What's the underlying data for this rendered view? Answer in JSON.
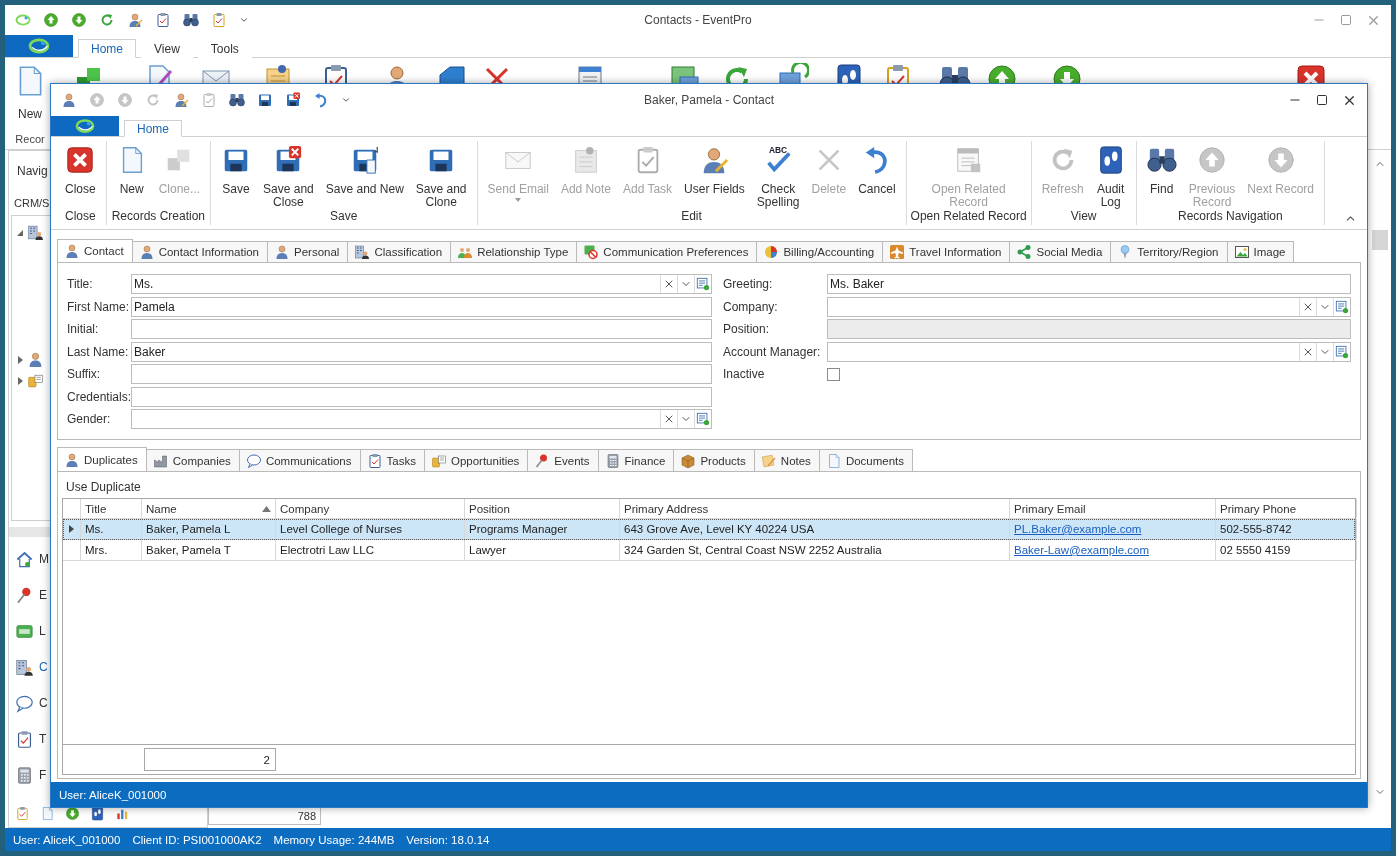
{
  "main_window": {
    "title": "Contacts - EventPro",
    "ribbon_tabs": [
      {
        "label": "Home",
        "selected": true
      },
      {
        "label": "View",
        "selected": false
      },
      {
        "label": "Tools",
        "selected": false
      }
    ],
    "ribbon_button": "New",
    "ribbon_group": "Recor",
    "navigation": {
      "title": "Navig",
      "tree_label": "CRM/S",
      "tree": [
        {
          "kind": "building",
          "expanded": true
        },
        {
          "kind": "person",
          "expanded": false
        },
        {
          "kind": "coins",
          "expanded": false
        }
      ],
      "items": [
        {
          "kind": "home",
          "label": "M",
          "selected": false
        },
        {
          "kind": "pushpin",
          "label": "E",
          "selected": false
        },
        {
          "kind": "card",
          "label": "L",
          "selected": false
        },
        {
          "kind": "building",
          "label": "C",
          "selected": true
        },
        {
          "kind": "bubble",
          "label": "C",
          "selected": false
        },
        {
          "kind": "task",
          "label": "T",
          "selected": false
        },
        {
          "kind": "calculator",
          "label": "F",
          "selected": false
        }
      ]
    },
    "footer_value": "788",
    "status_bar": [
      "User: AliceK_001000",
      "Client ID: PSI001000AK2",
      "Memory Usage: 244MB",
      "Version: 18.0.14"
    ]
  },
  "dialog": {
    "title": "Baker, Pamela - Contact",
    "ribbon_tabs": [
      {
        "label": "Home",
        "selected": true
      }
    ],
    "ribbon_groups": [
      {
        "label": "Close",
        "buttons": [
          {
            "kind": "close",
            "label": "Close",
            "disabled": false
          }
        ]
      },
      {
        "label": "Records Creation",
        "buttons": [
          {
            "kind": "doc",
            "label": "New",
            "disabled": false
          },
          {
            "kind": "cubes",
            "label": "Clone...",
            "disabled": true
          }
        ]
      },
      {
        "label": "Save",
        "buttons": [
          {
            "kind": "floppy",
            "label": "Save",
            "disabled": false
          },
          {
            "kind": "floppy_x",
            "label": "Save and\nClose",
            "disabled": false
          },
          {
            "kind": "floppy_new",
            "label": "Save and New",
            "disabled": false
          },
          {
            "kind": "floppy",
            "label": "Save and\nClone",
            "disabled": false
          }
        ]
      },
      {
        "label": "Edit",
        "buttons": [
          {
            "kind": "envelope",
            "label": "Send Email",
            "disabled": true,
            "dropdown": true
          },
          {
            "kind": "note",
            "label": "Add Note",
            "disabled": true
          },
          {
            "kind": "task",
            "label": "Add Task",
            "disabled": true
          },
          {
            "kind": "person_pencil",
            "label": "User Fields",
            "disabled": false
          },
          {
            "kind": "spelling",
            "label": "Check\nSpelling",
            "disabled": false,
            "icon_text": "ABC"
          },
          {
            "kind": "cross",
            "label": "Delete",
            "disabled": true
          },
          {
            "kind": "undo",
            "label": "Cancel",
            "disabled": false
          }
        ]
      },
      {
        "label": "Open Related Record",
        "buttons": [
          {
            "kind": "form",
            "label": "Open Related\nRecord",
            "disabled": true
          }
        ]
      },
      {
        "label": "View",
        "buttons": [
          {
            "kind": "refresh",
            "label": "Refresh",
            "disabled": true
          },
          {
            "kind": "footprints",
            "label": "Audit\nLog",
            "disabled": false
          }
        ]
      },
      {
        "label": "Records Navigation",
        "buttons": [
          {
            "kind": "binoculars",
            "label": "Find",
            "disabled": false
          },
          {
            "kind": "up",
            "label": "Previous\nRecord",
            "disabled": true
          },
          {
            "kind": "down",
            "label": "Next Record",
            "disabled": true
          }
        ]
      }
    ],
    "tabs": [
      {
        "kind": "person",
        "label": "Contact",
        "selected": true
      },
      {
        "kind": "person",
        "label": "Contact Information",
        "selected": false
      },
      {
        "kind": "person",
        "label": "Personal",
        "selected": false
      },
      {
        "kind": "building",
        "label": "Classification",
        "selected": false
      },
      {
        "kind": "people",
        "label": "Relationship Type",
        "selected": false
      },
      {
        "kind": "prohibited",
        "label": "Communication Preferences",
        "selected": false
      },
      {
        "kind": "pie",
        "label": "Billing/Accounting",
        "selected": false
      },
      {
        "kind": "plane",
        "label": "Travel Information",
        "selected": false
      },
      {
        "kind": "share",
        "label": "Social Media",
        "selected": false
      },
      {
        "kind": "mappin",
        "label": "Territory/Region",
        "selected": false
      },
      {
        "kind": "image",
        "label": "Image",
        "selected": false
      }
    ],
    "form": {
      "left": [
        {
          "kind": "combo",
          "label": "Title:",
          "value": "Ms.",
          "disabled": false
        },
        {
          "kind": "text",
          "label": "First Name:",
          "value": "Pamela",
          "disabled": false
        },
        {
          "kind": "text",
          "label": "Initial:",
          "disabled": false
        },
        {
          "kind": "text",
          "label": "Last Name:",
          "value": "Baker",
          "disabled": false
        },
        {
          "kind": "text",
          "label": "Suffix:",
          "disabled": false
        },
        {
          "kind": "text",
          "label": "Credentials:",
          "disabled": false
        },
        {
          "kind": "combo",
          "label": "Gender:",
          "disabled": false
        }
      ],
      "right": [
        {
          "kind": "text",
          "label": "Greeting:",
          "value": "Ms. Baker",
          "disabled": false
        },
        {
          "kind": "combo",
          "label": "Company:",
          "disabled": false
        },
        {
          "kind": "text",
          "label": "Position:",
          "disabled": true
        },
        {
          "kind": "combo",
          "label": "Account Manager:",
          "disabled": false
        },
        {
          "kind": "checkbox",
          "label": "Inactive",
          "checked": false
        }
      ]
    },
    "related_tabs": [
      {
        "kind": "person",
        "label": "Duplicates",
        "selected": true
      },
      {
        "kind": "factory",
        "label": "Companies",
        "selected": false
      },
      {
        "kind": "bubble",
        "label": "Communications",
        "selected": false
      },
      {
        "kind": "task",
        "label": "Tasks",
        "selected": false
      },
      {
        "kind": "coins",
        "label": "Opportunities",
        "selected": false
      },
      {
        "kind": "pushpin",
        "label": "Events",
        "selected": false
      },
      {
        "kind": "calculator",
        "label": "Finance",
        "selected": false
      },
      {
        "kind": "box",
        "label": "Products",
        "selected": false
      },
      {
        "kind": "notes",
        "label": "Notes",
        "selected": false
      },
      {
        "kind": "documents",
        "label": "Documents",
        "selected": false
      }
    ],
    "duplicates": {
      "action": "Use Duplicate",
      "columns": [
        {
          "label": "Title",
          "kind": "text",
          "sorted": false
        },
        {
          "label": "Name",
          "kind": "text",
          "sorted": true
        },
        {
          "label": "Company",
          "kind": "text",
          "sorted": false
        },
        {
          "label": "Position",
          "kind": "text",
          "sorted": false
        },
        {
          "label": "Primary Address",
          "kind": "text",
          "sorted": false
        },
        {
          "label": "Primary Email",
          "kind": "link",
          "sorted": false
        },
        {
          "label": "Primary Phone",
          "kind": "text",
          "sorted": false
        }
      ],
      "rows": [
        {
          "selected": true,
          "cells": [
            "Ms.",
            "Baker, Pamela L",
            "Level College of Nurses",
            "Programs Manager",
            "643 Grove Ave, Level KY 40224 USA",
            "PL.Baker@example.com",
            "502-555-8742"
          ]
        },
        {
          "selected": false,
          "cells": [
            "Mrs.",
            "Baker, Pamela T",
            "Electrotri Law LLC",
            "Lawyer",
            "324 Garden St, Central Coast NSW 2252 Australia",
            "Baker-Law@example.com",
            "02 5550 4159"
          ]
        }
      ],
      "footer": "2"
    },
    "status_bar": "User: AliceK_001000"
  }
}
